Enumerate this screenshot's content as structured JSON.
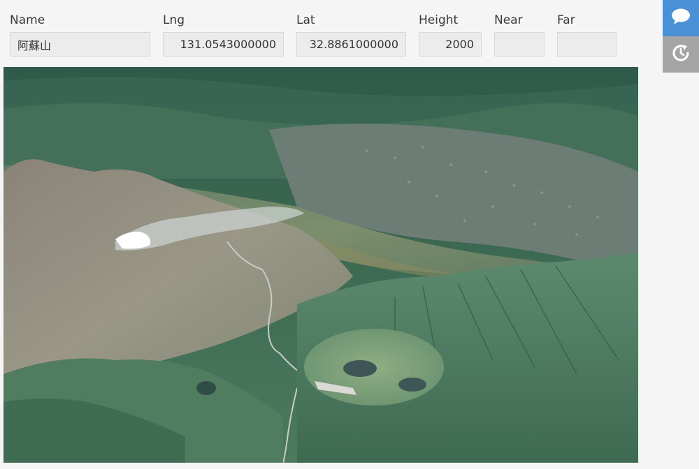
{
  "form": {
    "name_label": "Name",
    "name_value": "阿蘇山",
    "lng_label": "Lng",
    "lng_value": "131.0543000000",
    "lat_label": "Lat",
    "lat_value": "32.8861000000",
    "height_label": "Height",
    "height_value": "2000",
    "near_label": "Near",
    "near_value": "",
    "far_label": "Far",
    "far_value": ""
  },
  "sidebar": {
    "chat_icon": "speech-bubble-icon",
    "reload_icon": "refresh-clock-icon"
  },
  "colors": {
    "accent": "#4a90d6",
    "secondary_button": "#a5a5a5",
    "input_background": "#ececec"
  }
}
